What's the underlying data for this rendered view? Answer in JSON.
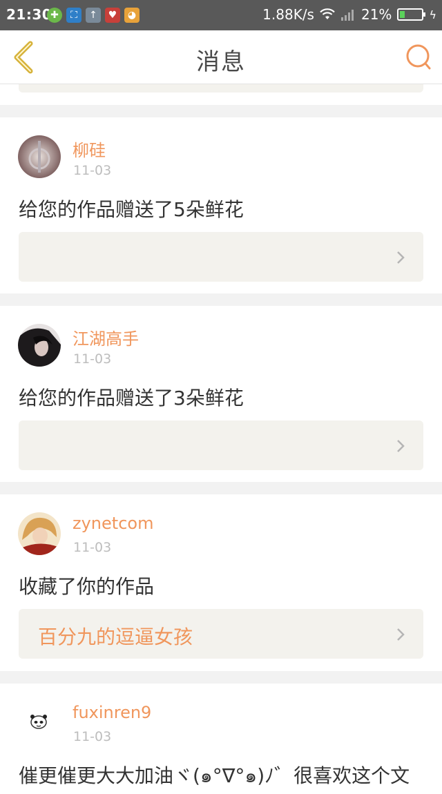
{
  "status_bar": {
    "time": "21:30",
    "net_speed": "1.88K/s",
    "battery": "21%"
  },
  "nav": {
    "title": "消息"
  },
  "colors": {
    "accent": "#f0965c",
    "status_bar": "#595959",
    "attachment_bg": "#f3f2ed"
  },
  "messages": [
    {
      "user": "柳硅",
      "date": "11-03",
      "text": "给您的作品赠送了5朵鲜花",
      "attachment": ""
    },
    {
      "user": "江湖高手",
      "date": "11-03",
      "text": "给您的作品赠送了3朵鲜花",
      "attachment": ""
    },
    {
      "user": "zynetcom",
      "date": "11-03",
      "text": "收藏了你的作品",
      "attachment": "百分九的逗逼女孩"
    },
    {
      "user": "fuxinren9",
      "date": "11-03",
      "text": "催更催更大大加油ヾ(๑°∇°๑)ﾉ゛很喜欢这个文",
      "attachment": ""
    }
  ]
}
